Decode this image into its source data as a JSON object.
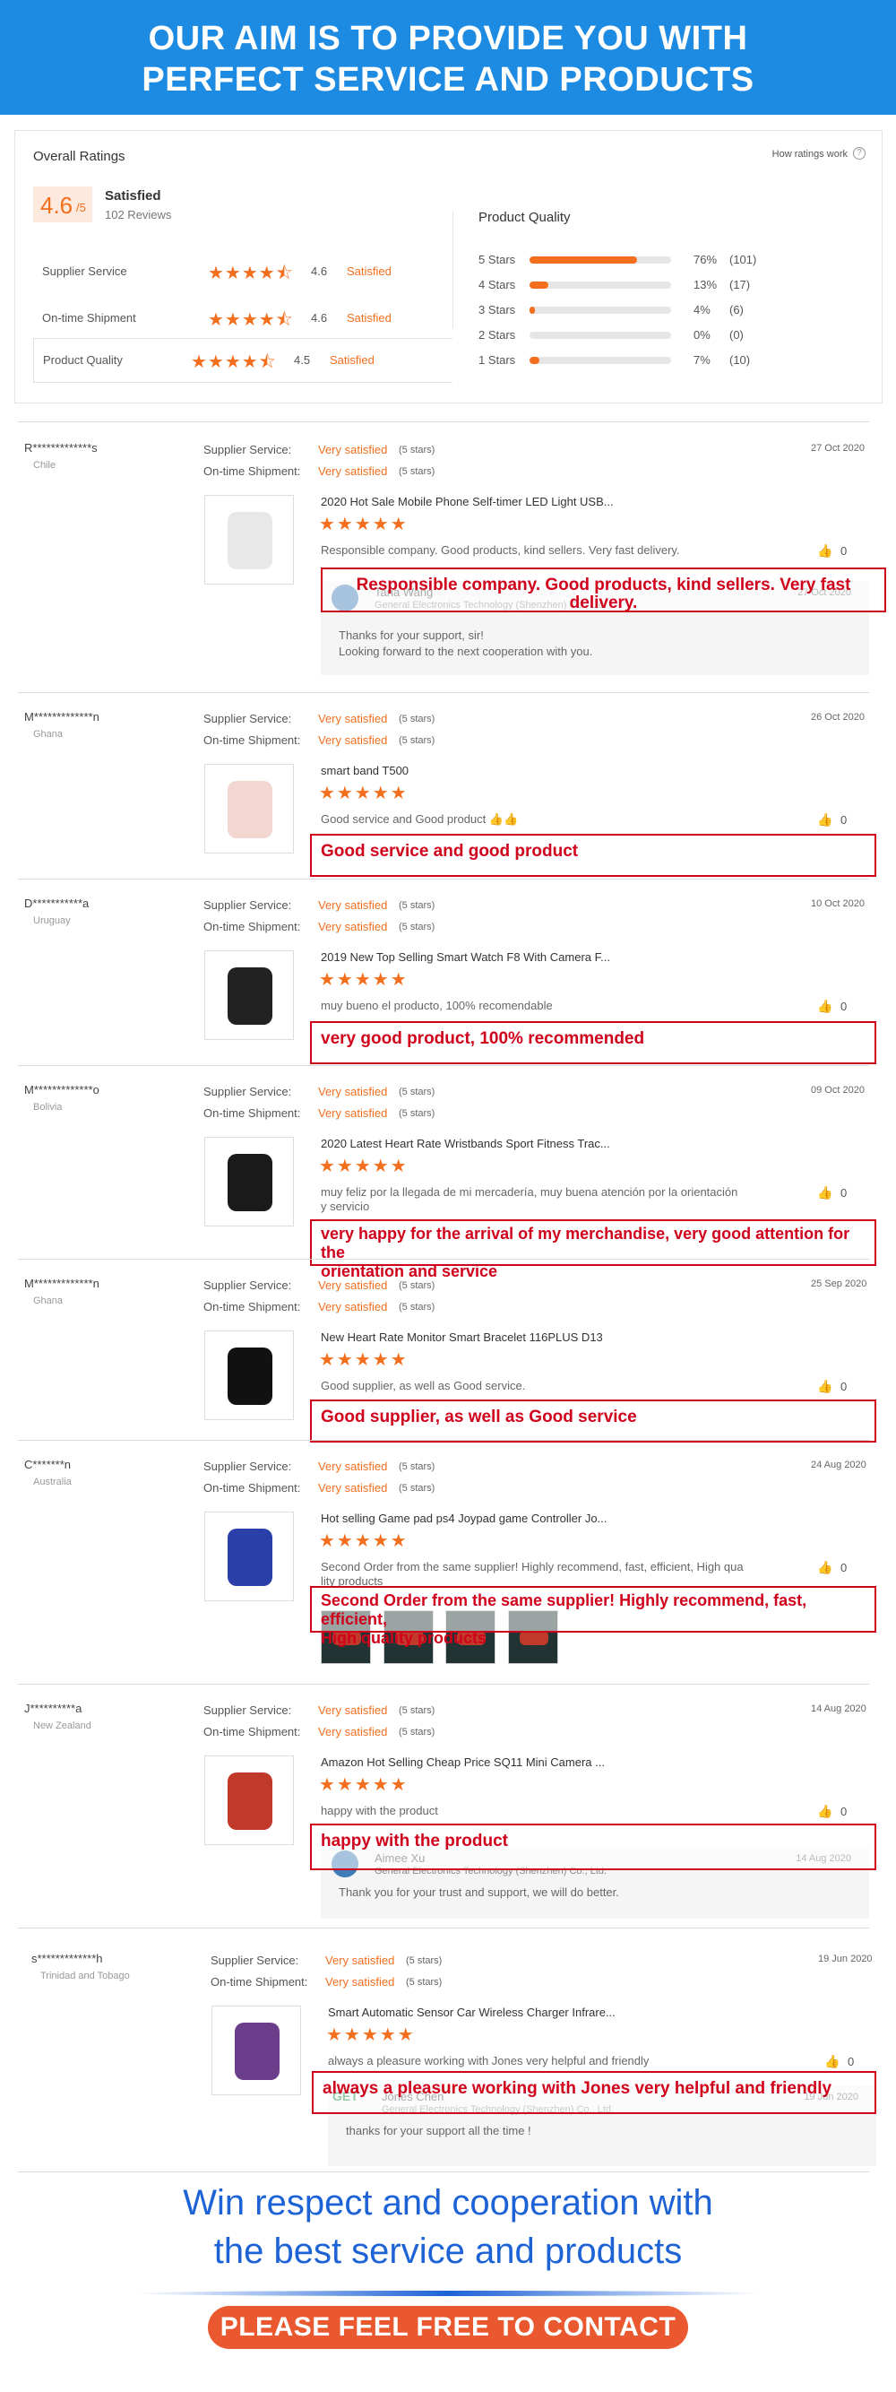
{
  "banner": {
    "line1": "OUR AIM IS TO PROVIDE YOU WITH",
    "line2": "PERFECT SERVICE AND PRODUCTS"
  },
  "overall": {
    "title": "Overall Ratings",
    "how_link": "How ratings work",
    "score": "4.6",
    "score_denom": "/5",
    "status": "Satisfied",
    "reviews": "102 Reviews",
    "rows": [
      {
        "label": "Supplier Service",
        "value": "4.6",
        "status": "Satisfied",
        "stars": "★★★★⯪"
      },
      {
        "label": "On-time Shipment",
        "value": "4.6",
        "status": "Satisfied",
        "stars": "★★★★⯪"
      },
      {
        "label": "Product Quality",
        "value": "4.5",
        "status": "Satisfied",
        "stars": "★★★★⯪"
      }
    ]
  },
  "quality": {
    "title": "Product Quality",
    "rows": [
      {
        "label": "5 Stars",
        "pct": "76%",
        "count": "(101)",
        "fill": 0.76
      },
      {
        "label": "4 Stars",
        "pct": "13%",
        "count": "(17)",
        "fill": 0.13
      },
      {
        "label": "3 Stars",
        "pct": "4%",
        "count": "(6)",
        "fill": 0.04
      },
      {
        "label": "2 Stars",
        "pct": "0%",
        "count": "(0)",
        "fill": 0.0
      },
      {
        "label": "1 Stars",
        "pct": "7%",
        "count": "(10)",
        "fill": 0.07
      }
    ]
  },
  "labels": {
    "supplier_service": "Supplier Service:",
    "ontime": "On-time Shipment:",
    "very_satisfied": "Very satisfied",
    "five_stars": "(5 stars)",
    "stars": "★★★★★",
    "like_count": "0"
  },
  "reviews": [
    {
      "user": "R*************s",
      "country": "Chile",
      "date": "27 Oct 2020",
      "product": "2020 Hot Sale Mobile Phone Self-timer LED Light USB...",
      "comment": "Responsible company.  Good products, kind sellers.  Very fast delivery.",
      "highlight": "Responsible company.  Good products, kind sellers.  Very fast delivery.",
      "reply": {
        "name": "Tana Wang",
        "company": "General Electronics Technology (Shenzhen) Co., Ltd.",
        "date": "27 Oct 2020",
        "line1": "Thanks for your support, sir!",
        "line2": "Looking forward to the next cooperation with you."
      }
    },
    {
      "user": "M*************n",
      "country": "Ghana",
      "date": "26 Oct 2020",
      "product": "smart band T500",
      "comment": "Good service and Good product 👍👍",
      "highlight": "Good service and good product"
    },
    {
      "user": "D***********a",
      "country": "Uruguay",
      "date": "10 Oct 2020",
      "product": "2019 New Top Selling Smart Watch F8 With Camera F...",
      "comment": "muy bueno el producto, 100% recomendable",
      "highlight": "very good product, 100% recommended"
    },
    {
      "user": "M*************o",
      "country": "Bolivia",
      "date": "09 Oct 2020",
      "product": "2020 Latest Heart Rate Wristbands Sport Fitness Trac...",
      "comment1": "muy feliz por la llegada de mi mercadería,  muy buena atención por la orientación",
      "comment2": "y servicio",
      "highlight1": "very happy for the arrival of my merchandise, very good attention for the",
      "highlight2": "orientation and service"
    },
    {
      "user": "M*************n",
      "country": "Ghana",
      "date": "25 Sep 2020",
      "product": "New Heart Rate Monitor Smart Bracelet 116PLUS D13",
      "comment": "Good supplier, as well as Good service.",
      "highlight": "Good supplier, as well as Good service"
    },
    {
      "user": "C*******n",
      "country": "Australia",
      "date": "24 Aug 2020",
      "product": "Hot selling Game pad ps4 Joypad game Controller Jo...",
      "comment1": "Second Order from the same supplier! Highly recommend, fast, efficient, High qua",
      "comment2": "lity products",
      "highlight1": "Second Order from the same supplier! Highly recommend, fast, efficient,",
      "highlight2": "High quality products"
    },
    {
      "user": "J**********a",
      "country": "New Zealand",
      "date": "14 Aug 2020",
      "product": "Amazon Hot Selling Cheap Price SQ11 Mini Camera ...",
      "comment": "happy with the product",
      "highlight": "happy with the product",
      "reply": {
        "name": "Aimee Xu",
        "company": "General Electronics Technology (Shenzhen) Co., Ltd.",
        "date": "14 Aug 2020",
        "line1": "Thank you for your trust and support, we will do better."
      }
    },
    {
      "user": "s*************h",
      "country": "Trinidad and Tobago",
      "date": "19 Jun 2020",
      "product": "Smart Automatic Sensor Car Wireless Charger Infrare...",
      "comment": "always a pleasure working with Jones very helpful and friendly",
      "highlight": "always a pleasure working with Jones very helpful and friendly",
      "reply": {
        "name": "Jones Chen",
        "company": "General Electronics Technology (Shenzhen) Co., Ltd.",
        "date": "19 Jun 2020",
        "line1": "thanks for your support all the time !",
        "logo": "GET"
      }
    }
  ],
  "footer": {
    "line1": "Win respect and cooperation with",
    "line2": "the best service and products",
    "contact": "PLEASE FEEL FREE TO CONTACT US"
  },
  "colors": {
    "banner": "#1e8be3",
    "accent": "#f36f1e",
    "highlight": "#d0021b",
    "footer_text": "#1d63d6",
    "contact_button": "#e9582f"
  }
}
